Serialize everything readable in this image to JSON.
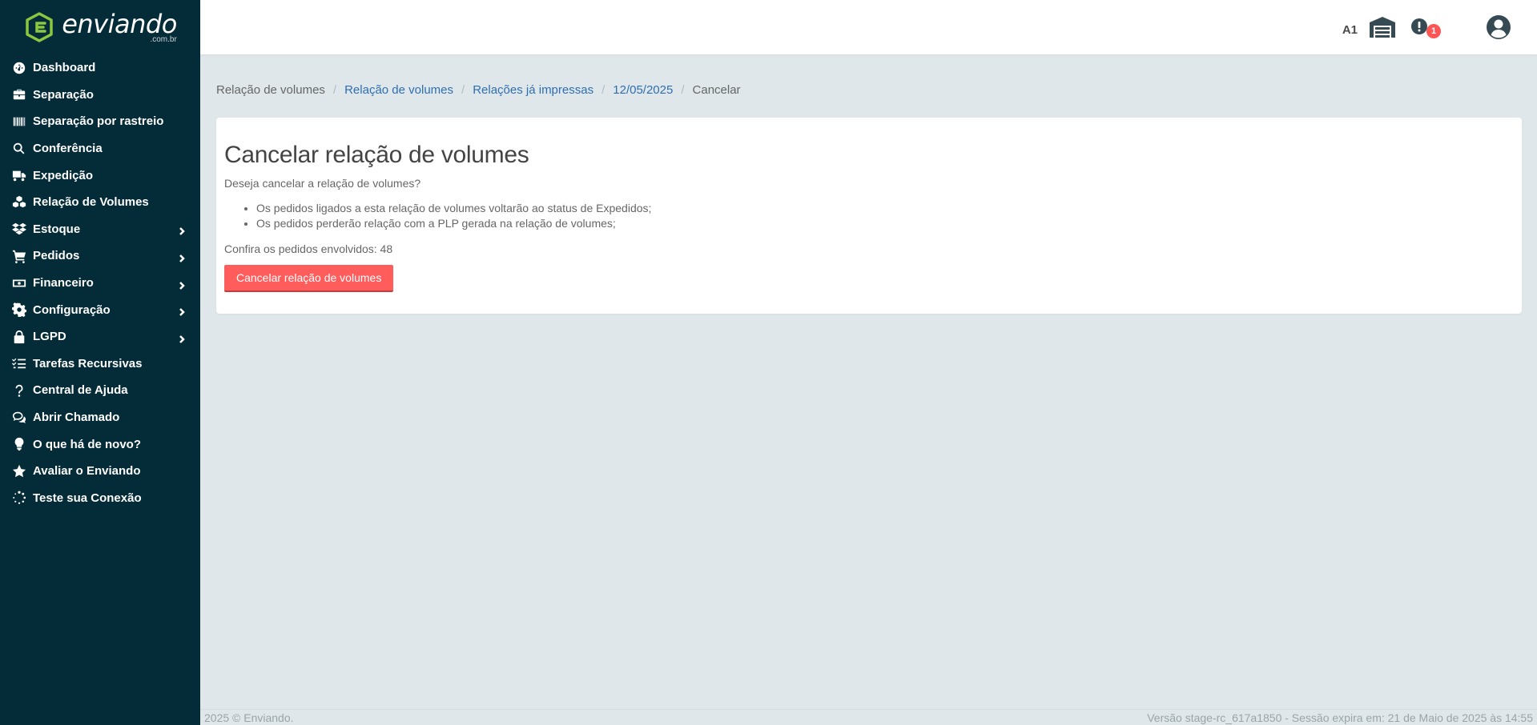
{
  "brand": {
    "name": "enviando",
    "domain": ".com.br",
    "accent": "#8dc63f"
  },
  "sidebar": {
    "items": [
      {
        "label": "Dashboard",
        "icon": "dashboard-icon",
        "has_submenu": false
      },
      {
        "label": "Separação",
        "icon": "toolbox-icon",
        "has_submenu": false
      },
      {
        "label": "Separação por rastreio",
        "icon": "barcode-icon",
        "has_submenu": false
      },
      {
        "label": "Conferência",
        "icon": "search-icon",
        "has_submenu": false
      },
      {
        "label": "Expedição",
        "icon": "truck-icon",
        "has_submenu": false
      },
      {
        "label": "Relação de Volumes",
        "icon": "boxes-icon",
        "has_submenu": false
      },
      {
        "label": "Estoque",
        "icon": "dropbox-icon",
        "has_submenu": true
      },
      {
        "label": "Pedidos",
        "icon": "cart-icon",
        "has_submenu": true
      },
      {
        "label": "Financeiro",
        "icon": "money-icon",
        "has_submenu": true
      },
      {
        "label": "Configuração",
        "icon": "gear-icon",
        "has_submenu": true
      },
      {
        "label": "LGPD",
        "icon": "lock-icon",
        "has_submenu": true
      },
      {
        "label": "Tarefas Recursivas",
        "icon": "tasks-icon",
        "has_submenu": false
      },
      {
        "label": "Central de Ajuda",
        "icon": "question-icon",
        "has_submenu": false
      },
      {
        "label": "Abrir Chamado",
        "icon": "chat-icon",
        "has_submenu": false
      },
      {
        "label": "O que há de novo?",
        "icon": "lightbulb-icon",
        "has_submenu": false
      },
      {
        "label": "Avaliar o Enviando",
        "icon": "star-icon",
        "has_submenu": false
      },
      {
        "label": "Teste sua Conexão",
        "icon": "spinner-icon",
        "has_submenu": false
      }
    ]
  },
  "topbar": {
    "user_code": "A1",
    "alert_count": "1"
  },
  "breadcrumb": [
    {
      "label": "Relação de volumes",
      "link": false
    },
    {
      "label": "Relação de volumes",
      "link": true
    },
    {
      "label": "Relações já impressas",
      "link": true
    },
    {
      "label": "12/05/2025",
      "link": true
    },
    {
      "label": "Cancelar",
      "link": false
    }
  ],
  "card": {
    "title": "Cancelar relação de volumes",
    "question": "Deseja cancelar a relação de volumes?",
    "bullets": [
      "Os pedidos ligados a esta relação de volumes voltarão ao status de Expedidos;",
      "Os pedidos perderão relação com a PLP gerada na relação de volumes;"
    ],
    "orders_text": "Confira os pedidos envolvidos: 48",
    "button_label": "Cancelar relação de volumes",
    "button_color": "#ff5c5c"
  },
  "footer": {
    "copyright": "2025 © Enviando.",
    "version": "Versão stage-rc_617a1850 - Sessão expira em: 21 de Maio de 2025 às 14:55"
  }
}
